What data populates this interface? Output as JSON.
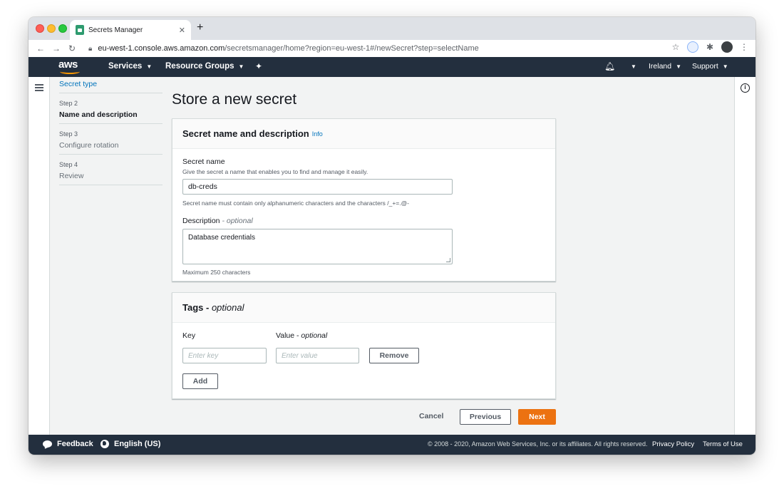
{
  "browser": {
    "tab_title": "Secrets Manager",
    "tab_close": "✕",
    "new_tab": "+",
    "url_host": "eu-west-1.console.aws.amazon.com",
    "url_path": "/secretsmanager/home?region=eu-west-1#/newSecret?step=selectName"
  },
  "aws_nav": {
    "logo": "aws",
    "services": "Services",
    "resource_groups": "Resource Groups",
    "region": "Ireland",
    "support": "Support"
  },
  "steps": {
    "previous_link": "Secret type",
    "items": [
      {
        "num": "Step 2",
        "label": "Name and description"
      },
      {
        "num": "Step 3",
        "label": "Configure rotation"
      },
      {
        "num": "Step 4",
        "label": "Review"
      }
    ]
  },
  "page_title": "Store a new secret",
  "secret_panel": {
    "title": "Secret name and description",
    "info": "Info",
    "name_label": "Secret name",
    "name_desc": "Give the secret a name that enables you to find and manage it easily.",
    "name_value": "db-creds",
    "name_hint": "Secret name must contain only alphanumeric characters and the characters /_+=.@-",
    "desc_label": "Description",
    "desc_optional": "- optional",
    "desc_value": "Database credentials",
    "desc_hint": "Maximum 250 characters"
  },
  "tags_panel": {
    "title": "Tags - ",
    "title_optional": "optional",
    "key_label": "Key",
    "value_label": "Value - ",
    "value_optional": "optional",
    "key_placeholder": "Enter key",
    "value_placeholder": "Enter value",
    "remove": "Remove",
    "add": "Add"
  },
  "actions": {
    "cancel": "Cancel",
    "previous": "Previous",
    "next": "Next"
  },
  "footer": {
    "feedback": "Feedback",
    "language": "English (US)",
    "copyright": "© 2008 - 2020, Amazon Web Services, Inc. or its affiliates. All rights reserved.",
    "privacy": "Privacy Policy",
    "terms": "Terms of Use"
  },
  "colors": {
    "aws_nav": "#232f3e",
    "primary_button": "#ec7211",
    "link": "#0073bb"
  }
}
